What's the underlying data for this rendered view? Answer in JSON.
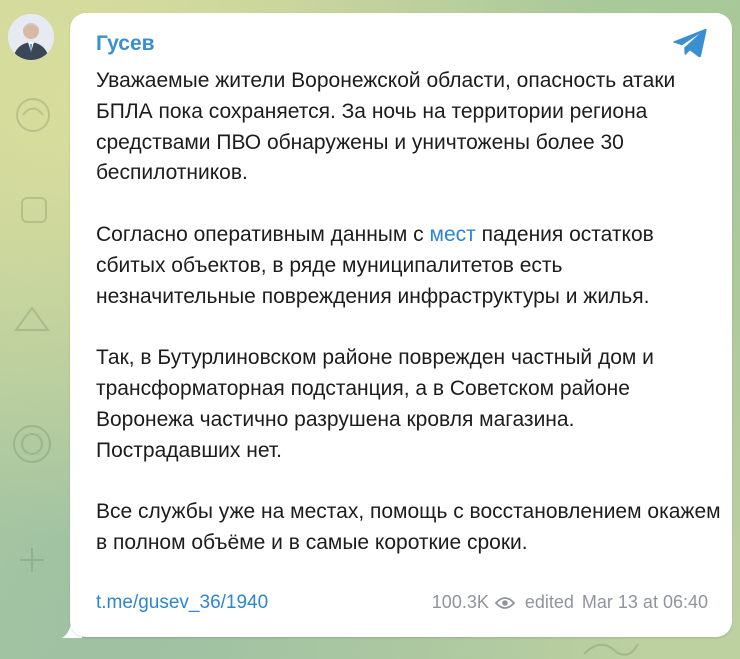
{
  "channel": {
    "author_name": "Гусев",
    "app_icon": "telegram-plane-icon",
    "avatar_icon": "channel-avatar-photo"
  },
  "message": {
    "p1": "Уважаемые жители Воронежской области, опасность атаки БПЛА пока сохраняется. За ночь на территории региона средствами ПВО обнаружены и уничтожены более 30 беспилотников.",
    "p2_before": "Согласно оперативным данным с ",
    "p2_link": "мест",
    "p2_after": " падения остатков сбитых объектов, в ряде муниципалитетов есть незначительные повреждения инфраструктуры и жилья.",
    "p3": "Так, в Бутурлиновском районе поврежден частный дом и трансформаторная подстанция, а в Советском районе Воронежа частично разрушена кровля магазина. Пострадавших нет.",
    "p4": "Все службы уже на местах, помощь с восстановлением окажем в полном объёме и в самые короткие сроки."
  },
  "footer": {
    "post_link": "t.me/gusev_36/1940",
    "views": "100.3K",
    "views_icon": "eye-icon",
    "edited_label": "edited",
    "timestamp": "Mar 13 at 06:40"
  },
  "colors": {
    "accent": "#3a8fd0",
    "link": "#2e86cf",
    "meta": "#8f959b",
    "bubble": "#ffffff"
  }
}
